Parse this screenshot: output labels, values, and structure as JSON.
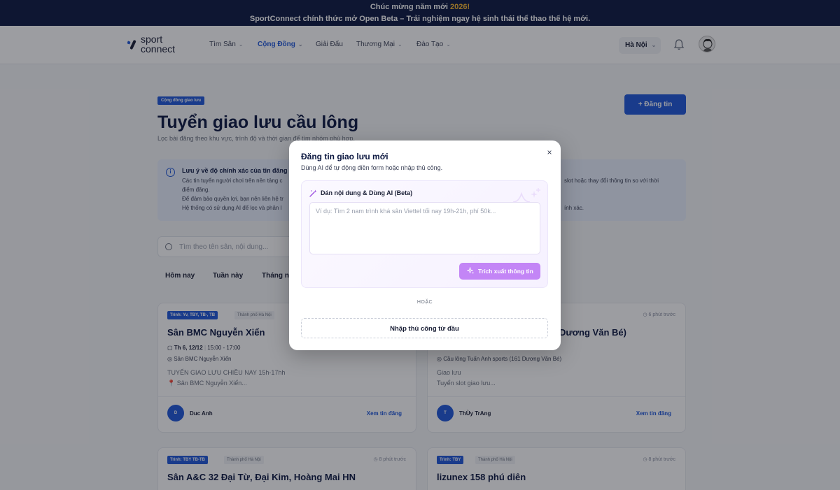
{
  "banner": {
    "line1_prefix": "Chúc mừng năm mới ",
    "line1_year": "2026!",
    "line2": "SportConnect chính thức mở Open Beta – Trải nghiệm ngay hệ sinh thái thể thao thế hệ mới."
  },
  "header": {
    "logo_line1": "sport",
    "logo_line2": "connect",
    "nav": [
      {
        "label": "Tìm Sân",
        "has_dropdown": true,
        "active": false
      },
      {
        "label": "Cộng Đồng",
        "has_dropdown": true,
        "active": true
      },
      {
        "label": "Giải Đấu",
        "has_dropdown": false,
        "active": false
      },
      {
        "label": "Thương Mại",
        "has_dropdown": true,
        "active": false
      },
      {
        "label": "Đào Tạo",
        "has_dropdown": true,
        "active": false
      }
    ],
    "city": "Hà Nội",
    "icons": {
      "bell": "bell-icon",
      "avatar": "user-avatar"
    }
  },
  "page": {
    "badge": "Cộng đồng giao lưu",
    "title": "Tuyển giao lưu cầu lông",
    "subtitle": "Lọc bài đăng theo khu vực, trình độ và thời gian để tìm nhóm phù hợp.",
    "post_button": "+ Đăng tin",
    "info": {
      "title": "Lưu ý về độ chính xác của tin đăng",
      "lines": [
        "Các tin tuyển người chơi trên nền tảng c",
        "điểm đăng.",
        "Để đảm bảo quyền lợi, bạn nên liên hệ tr",
        "Hệ thống có sử dụng AI để lọc và phân l"
      ],
      "right_lines": [
        "slot hoặc thay đổi thông tin so với thời",
        "ính xác."
      ]
    },
    "search_placeholder": "Tìm theo tên sân, nội dung...",
    "filters": [
      "Hôm nay",
      "Tuần này",
      "Tháng n"
    ]
  },
  "cards": [
    {
      "tag": "Trình: Yv, TBY, TB-, TB",
      "city": "Thành phố Hà Nội",
      "time": "",
      "title": "Sân BMC Nguyễn Xiển",
      "date": "Th 6, 12/12",
      "hours": "15:00 - 17:00",
      "location": "Sân BMC Nguyễn Xiển",
      "desc1": "TUYỂN GIAO LƯU CHIỀU NAY 15h-17hh",
      "desc2": "📍 Sân BMC Nguyễn Xiển...",
      "avatar_initial": "D",
      "author": "Duc Anh",
      "view": "Xem tin đăng"
    },
    {
      "tag": "",
      "city": "",
      "time": "6 phút trước",
      "title": "Dương Văn Bé)",
      "date": "",
      "hours": "",
      "location": "Cầu lông Tuấn Anh sports (161 Dương Văn Bé)",
      "desc1": "Giao lưu",
      "desc2": "Tuyển slot giao lưu...",
      "avatar_initial": "T",
      "author": "ThÙy TrAng",
      "view": "Xem tin đăng"
    },
    {
      "tag": "Trình: TBY TB-TB",
      "city": "Thành phố Hà Nội",
      "time": "8 phút trước",
      "title": "Sân A&C 32 Đại Từ, Đại Kim, Hoàng Mai HN"
    },
    {
      "tag": "Trình: TBY",
      "city": "Thành phố Hà Nội",
      "time": "8 phút trước",
      "title": "lizunex 158 phú diên"
    }
  ],
  "modal": {
    "title": "Đăng tin giao lưu mới",
    "subtitle": "Dùng AI để tự động điền form hoặc nhập thủ công.",
    "ai_title": "Dán nội dung & Dùng AI (Beta)",
    "ai_placeholder": "Ví dụ: Tìm 2 nam trình khá sân Viettel tối nay 19h-21h, phí 50k...",
    "extract_button": "Trích xuất thông tin",
    "or_text": "HOẶC",
    "manual_button": "Nhập thủ công từ đầu",
    "close": "×",
    "colors": {
      "accent": "#c385f6",
      "brand": "#1e56d9"
    }
  }
}
